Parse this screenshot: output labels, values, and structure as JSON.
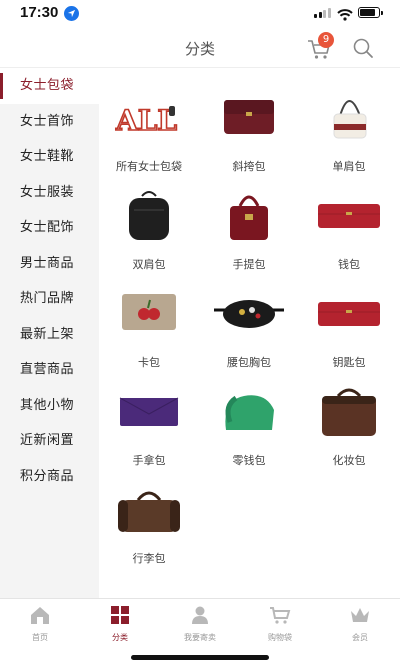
{
  "status": {
    "time": "17:30"
  },
  "header": {
    "title": "分类",
    "cart_count": "9"
  },
  "sidebar": {
    "items": [
      {
        "label": "女士包袋",
        "active": true
      },
      {
        "label": "女士首饰"
      },
      {
        "label": "女士鞋靴"
      },
      {
        "label": "女士服装"
      },
      {
        "label": "女士配饰"
      },
      {
        "label": "男士商品"
      },
      {
        "label": "热门品牌"
      },
      {
        "label": "最新上架"
      },
      {
        "label": "直营商品"
      },
      {
        "label": "其他小物"
      },
      {
        "label": "近新闲置"
      },
      {
        "label": "积分商品"
      }
    ]
  },
  "grid": {
    "items": [
      {
        "label": "所有女士包袋",
        "icon": "all-bags-icon",
        "logo_text": "ALL"
      },
      {
        "label": "斜挎包",
        "icon": "crossbody-bag-icon"
      },
      {
        "label": "单肩包",
        "icon": "shoulder-bag-icon"
      },
      {
        "label": "双肩包",
        "icon": "backpack-icon"
      },
      {
        "label": "手提包",
        "icon": "handbag-icon"
      },
      {
        "label": "钱包",
        "icon": "wallet-icon"
      },
      {
        "label": "卡包",
        "icon": "card-holder-icon"
      },
      {
        "label": "腰包胸包",
        "icon": "belt-bag-icon"
      },
      {
        "label": "钥匙包",
        "icon": "key-pouch-icon"
      },
      {
        "label": "手拿包",
        "icon": "clutch-icon"
      },
      {
        "label": "零钱包",
        "icon": "coin-purse-icon"
      },
      {
        "label": "化妆包",
        "icon": "cosmetic-case-icon"
      },
      {
        "label": "行李包",
        "icon": "travel-bag-icon"
      }
    ]
  },
  "tabbar": {
    "items": [
      {
        "label": "首页",
        "icon": "home-icon"
      },
      {
        "label": "分类",
        "icon": "category-icon",
        "active": true
      },
      {
        "label": "我要寄卖",
        "icon": "consign-icon"
      },
      {
        "label": "购物袋",
        "icon": "cart-icon"
      },
      {
        "label": "会员",
        "icon": "crown-icon"
      }
    ]
  },
  "colors": {
    "accent": "#8b1e2b",
    "badge": "#e8553a",
    "sidebar_bg": "#f4f4f4"
  }
}
